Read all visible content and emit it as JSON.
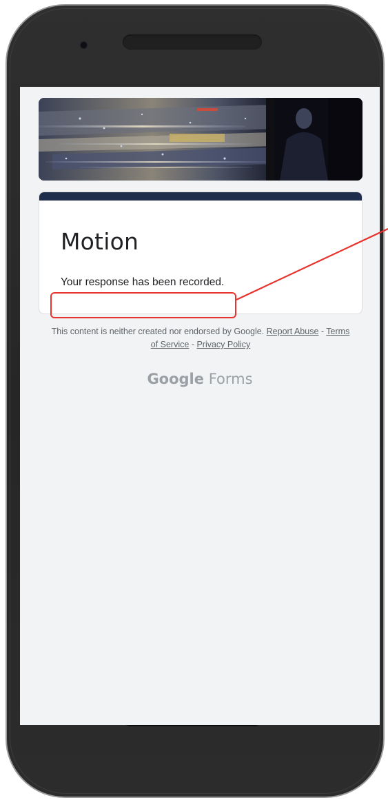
{
  "form": {
    "title": "Motion",
    "confirmation_message": "Your response has been recorded."
  },
  "footer": {
    "disclaimer_text": "This content is neither created nor endorsed by Google.",
    "report_abuse_label": "Report Abuse",
    "separator": " - ",
    "terms_label": "Terms of Service",
    "privacy_label": "Privacy Policy",
    "brand_google": "Google",
    "brand_forms": "Forms"
  },
  "colors": {
    "accent_bar": "#1f2d4d",
    "annotation": "#e8322c",
    "page_background": "#f1f3f4"
  },
  "icons": {
    "camera": "camera-icon",
    "speaker": "speaker-grille"
  }
}
